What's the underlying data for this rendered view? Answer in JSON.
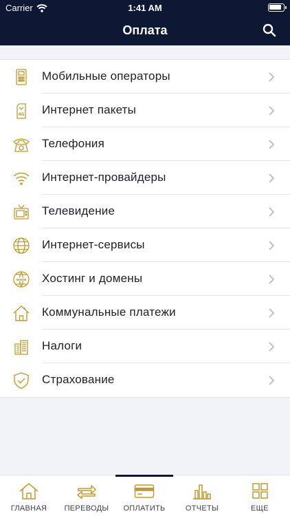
{
  "status_bar": {
    "carrier": "Carrier",
    "time": "1:41 AM"
  },
  "header": {
    "title": "Оплата"
  },
  "menu": {
    "items": [
      {
        "label": "Мобильные операторы",
        "icon": "mobile-phone-icon"
      },
      {
        "label": "Интернет пакеты",
        "icon": "sim-card-4g-icon"
      },
      {
        "label": "Телефония",
        "icon": "telephone-icon"
      },
      {
        "label": "Интернет-провайдеры",
        "icon": "wifi-icon"
      },
      {
        "label": "Телевидение",
        "icon": "tv-icon"
      },
      {
        "label": "Интернет-сервисы",
        "icon": "globe-icon"
      },
      {
        "label": "Хостинг и домены",
        "icon": "www-globe-icon"
      },
      {
        "label": "Коммунальные платежи",
        "icon": "house-icon"
      },
      {
        "label": "Налоги",
        "icon": "buildings-icon"
      },
      {
        "label": "Страхование",
        "icon": "shield-check-icon"
      }
    ]
  },
  "tabbar": {
    "tabs": [
      {
        "label": "ГЛАВНАЯ",
        "icon": "home-icon"
      },
      {
        "label": "ПЕРЕВОДЫ",
        "icon": "transfer-arrows-icon"
      },
      {
        "label": "ОПЛАТИТЬ",
        "icon": "credit-card-icon",
        "active": true
      },
      {
        "label": "ОТЧЕТЫ",
        "icon": "bar-chart-icon"
      },
      {
        "label": "ЕЩЕ",
        "icon": "grid-icon"
      }
    ]
  },
  "colors": {
    "header_bg": "#0c1834",
    "accent_gold": "#c19a2e",
    "page_bg": "#f1f3f8"
  }
}
